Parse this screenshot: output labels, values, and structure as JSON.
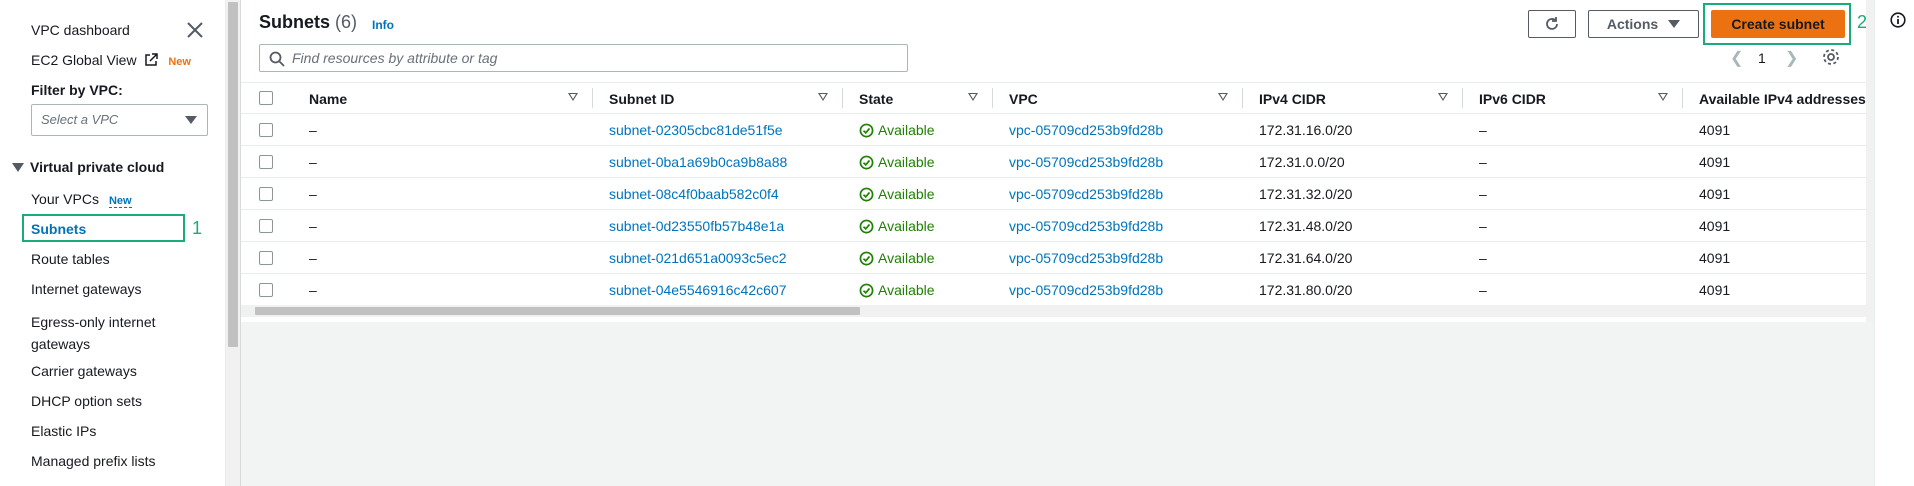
{
  "sidebar": {
    "dashboard": "VPC dashboard",
    "ec2_global_view": "EC2 Global View",
    "ec2_new_badge": "New",
    "filter_label": "Filter by VPC:",
    "filter_placeholder": "Select a VPC",
    "section_title": "Virtual private cloud",
    "items": [
      {
        "label": "Your VPCs",
        "badge": "New"
      },
      {
        "label": "Subnets"
      },
      {
        "label": "Route tables"
      },
      {
        "label": "Internet gateways"
      },
      {
        "label": "Egress-only internet gateways"
      },
      {
        "label": "Carrier gateways"
      },
      {
        "label": "DHCP option sets"
      },
      {
        "label": "Elastic IPs"
      },
      {
        "label": "Managed prefix lists"
      }
    ],
    "step1": "1"
  },
  "header": {
    "title": "Subnets",
    "count": "(6)",
    "info": "Info",
    "actions_label": "Actions",
    "create_label": "Create subnet",
    "step2": "2",
    "search_placeholder": "Find resources by attribute or tag",
    "page_number": "1"
  },
  "table": {
    "columns": [
      "Name",
      "Subnet ID",
      "State",
      "VPC",
      "IPv4 CIDR",
      "IPv6 CIDR",
      "Available IPv4 addresses"
    ],
    "rows": [
      {
        "name": "–",
        "subnet_id": "subnet-02305cbc81de51f5e",
        "state": "Available",
        "vpc": "vpc-05709cd253b9fd28b",
        "ipv4": "172.31.16.0/20",
        "ipv6": "–",
        "avail": "4091"
      },
      {
        "name": "–",
        "subnet_id": "subnet-0ba1a69b0ca9b8a88",
        "state": "Available",
        "vpc": "vpc-05709cd253b9fd28b",
        "ipv4": "172.31.0.0/20",
        "ipv6": "–",
        "avail": "4091"
      },
      {
        "name": "–",
        "subnet_id": "subnet-08c4f0baab582c0f4",
        "state": "Available",
        "vpc": "vpc-05709cd253b9fd28b",
        "ipv4": "172.31.32.0/20",
        "ipv6": "–",
        "avail": "4091"
      },
      {
        "name": "–",
        "subnet_id": "subnet-0d23550fb57b48e1a",
        "state": "Available",
        "vpc": "vpc-05709cd253b9fd28b",
        "ipv4": "172.31.48.0/20",
        "ipv6": "–",
        "avail": "4091"
      },
      {
        "name": "–",
        "subnet_id": "subnet-021d651a0093c5ec2",
        "state": "Available",
        "vpc": "vpc-05709cd253b9fd28b",
        "ipv4": "172.31.64.0/20",
        "ipv6": "–",
        "avail": "4091"
      },
      {
        "name": "–",
        "subnet_id": "subnet-04e5546916c42c607",
        "state": "Available",
        "vpc": "vpc-05709cd253b9fd28b",
        "ipv4": "172.31.80.0/20",
        "ipv6": "–",
        "avail": "4091"
      }
    ]
  },
  "colors": {
    "accent": "#ec7211",
    "link": "#0073bb",
    "success": "#1d8102",
    "highlight": "#1aab7a"
  },
  "icons": [
    "close-icon",
    "external-link-icon",
    "refresh-icon",
    "search-icon",
    "settings-icon",
    "check-circle-icon",
    "info-icon"
  ]
}
